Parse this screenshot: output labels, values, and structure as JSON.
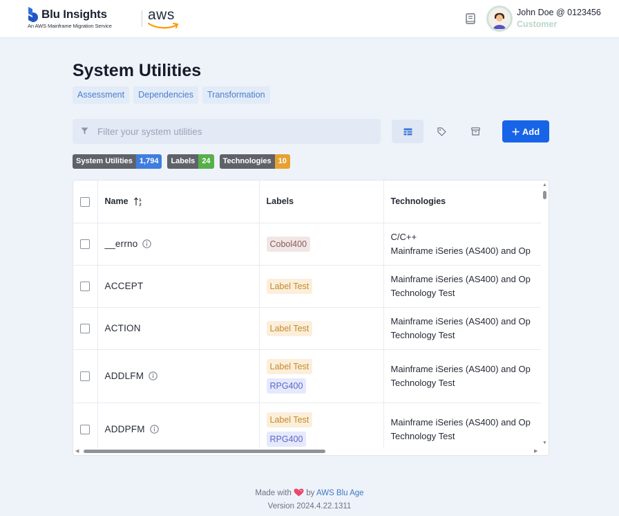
{
  "header": {
    "brand_name": "Blu Insights",
    "brand_subtitle": "An AWS Mainframe Migration Service",
    "aws_logo_text": "aws",
    "user_name": "John Doe @ 0123456",
    "user_role": "Customer",
    "icons": [
      "docs-book-icon",
      "avatar"
    ]
  },
  "page": {
    "title": "System Utilities",
    "tabs": [
      "Assessment",
      "Dependencies",
      "Transformation"
    ]
  },
  "toolbar": {
    "filter_placeholder": "Filter your system utilities",
    "add_label": "Add",
    "view_buttons": [
      "table-view-icon",
      "tag-icon",
      "archive-icon"
    ]
  },
  "stats": [
    {
      "label": "System Utilities",
      "value": "1,794",
      "color": "#3f7ee0"
    },
    {
      "label": "Labels",
      "value": "24",
      "color": "#56b04a"
    },
    {
      "label": "Technologies",
      "value": "10",
      "color": "#e7a132"
    }
  ],
  "table": {
    "columns": [
      "Name",
      "Labels",
      "Technologies"
    ],
    "rows": [
      {
        "name": "__errno",
        "info": true,
        "labels": [
          {
            "text": "Cobol400",
            "bg": "#f1e6e6",
            "fg": "#8a5a5a"
          }
        ],
        "tech": [
          "C/C++",
          "Mainframe iSeries (AS400) and Op"
        ]
      },
      {
        "name": "ACCEPT",
        "info": false,
        "labels": [
          {
            "text": "Label Test",
            "bg": "#fbefdb",
            "fg": "#c58a2a"
          }
        ],
        "tech": [
          "Mainframe iSeries (AS400) and Op",
          "Technology Test"
        ]
      },
      {
        "name": "ACTION",
        "info": false,
        "labels": [
          {
            "text": "Label Test",
            "bg": "#fbefdb",
            "fg": "#c58a2a"
          }
        ],
        "tech": [
          "Mainframe iSeries (AS400) and Op",
          "Technology Test"
        ]
      },
      {
        "name": "ADDLFM",
        "info": true,
        "labels": [
          {
            "text": "Label Test",
            "bg": "#fbefdb",
            "fg": "#c58a2a"
          },
          {
            "text": "RPG400",
            "bg": "#e6e9fb",
            "fg": "#5b66c9"
          }
        ],
        "tech": [
          "Mainframe iSeries (AS400) and Op",
          "Technology Test"
        ]
      },
      {
        "name": "ADDPFM",
        "info": true,
        "labels": [
          {
            "text": "Label Test",
            "bg": "#fbefdb",
            "fg": "#c58a2a"
          },
          {
            "text": "RPG400",
            "bg": "#e6e9fb",
            "fg": "#5b66c9"
          }
        ],
        "tech": [
          "Mainframe iSeries (AS400) and Op",
          "Technology Test"
        ]
      }
    ]
  },
  "footer": {
    "made_with": "Made with",
    "by": "by",
    "company": "AWS Blu Age",
    "version": "Version 2024.4.22.1311"
  }
}
